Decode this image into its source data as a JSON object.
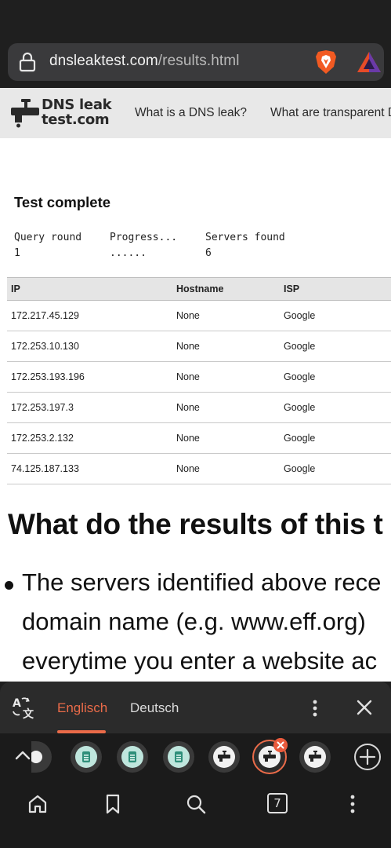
{
  "browser": {
    "url_host": "dnsleaktest.com",
    "url_path": "/results.html",
    "icons": [
      "lock-icon",
      "brave-shields-icon",
      "brave-rewards-icon"
    ]
  },
  "site": {
    "logo_line1": "DNS leak",
    "logo_line2": "test.com",
    "nav": [
      "What is a DNS leak?",
      "What are transparent D"
    ]
  },
  "test": {
    "title": "Test complete",
    "progress_headers": [
      "Query round",
      "Progress...",
      "Servers found"
    ],
    "progress_values": [
      "1",
      "......",
      "6"
    ]
  },
  "results": {
    "columns": [
      "IP",
      "Hostname",
      "ISP"
    ],
    "rows": [
      [
        "172.217.45.129",
        "None",
        "Google"
      ],
      [
        "172.253.10.130",
        "None",
        "Google"
      ],
      [
        "172.253.193.196",
        "None",
        "Google"
      ],
      [
        "172.253.197.3",
        "None",
        "Google"
      ],
      [
        "172.253.2.132",
        "None",
        "Google"
      ],
      [
        "74.125.187.133",
        "None",
        "Google"
      ]
    ]
  },
  "article": {
    "heading": "What do the results of this t",
    "bullet_lines": [
      "The servers identified above rece",
      "domain name (e.g. www.eff.org)",
      "everytime you enter a website ac"
    ]
  },
  "translate": {
    "source_lang": "Englisch",
    "target_lang": "Deutsch",
    "accent": "#ea6b49"
  },
  "tabs": {
    "count": "7"
  }
}
